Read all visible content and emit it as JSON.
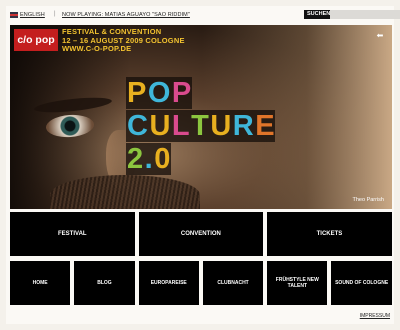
{
  "topbar": {
    "language": "ENGLISH",
    "separator": "|",
    "now_playing": "NOW PLAYING: MATIAS AGUAYO \"SAO RIDDIM\"",
    "search_label": "SUCHEN",
    "search_value": ""
  },
  "hero": {
    "logo": "c/o pop",
    "festival_line1": "FESTIVAL & CONVENTION",
    "festival_line2": "12 – 16 AUGUST 2009 COLOGNE",
    "festival_line3": "WWW.C-O-POP.DE",
    "headline_rows": [
      [
        {
          "ch": "P",
          "color": "#e8b020"
        },
        {
          "ch": "O",
          "color": "#3fb6d9"
        },
        {
          "ch": "P",
          "color": "#d94b8e"
        }
      ],
      [
        {
          "ch": "C",
          "color": "#3fb6d9"
        },
        {
          "ch": "U",
          "color": "#e8b020"
        },
        {
          "ch": "L",
          "color": "#d94b8e"
        },
        {
          "ch": "T",
          "color": "#8cc63f"
        },
        {
          "ch": "U",
          "color": "#e8b020"
        },
        {
          "ch": "R",
          "color": "#3fb6d9"
        },
        {
          "ch": "E",
          "color": "#e0752a"
        }
      ],
      [
        {
          "ch": "2",
          "color": "#8cc63f"
        },
        {
          "ch": ".",
          "color": "#3fb6d9"
        },
        {
          "ch": "0",
          "color": "#e8b020"
        }
      ]
    ],
    "credit": "Theo Parrish"
  },
  "nav": {
    "main": [
      "FESTIVAL",
      "CONVENTION",
      "TICKETS"
    ],
    "secondary": [
      "HOME",
      "BLOG",
      "EUROPAREISE",
      "CLUBNACHT",
      "FRÜHSTYLE NEW TALENT",
      "SOUND OF COLOGNE"
    ]
  },
  "footer": {
    "impressum": "IMPRESSUM"
  }
}
